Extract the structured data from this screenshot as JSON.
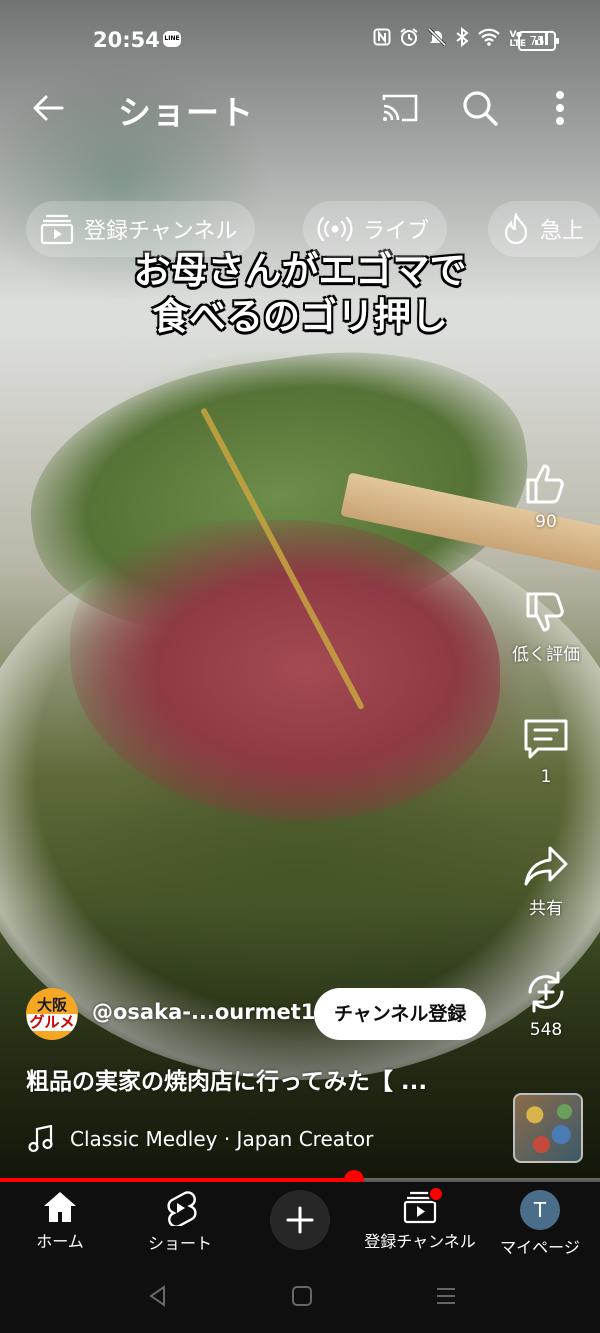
{
  "status_bar": {
    "time": "20:54",
    "line_icon_text": "LINE",
    "battery": "75",
    "icons": [
      "nfc-icon",
      "alarm-icon",
      "mute-icon",
      "bluetooth-icon",
      "wifi-icon",
      "volte-icon",
      "signal-icon",
      "battery-icon"
    ]
  },
  "header": {
    "title": "ショート"
  },
  "chips": [
    {
      "label": "登録チャンネル",
      "icon": "subscriptions-icon"
    },
    {
      "label": "ライブ",
      "icon": "live-icon"
    },
    {
      "label": "急上",
      "icon": "trending-icon"
    }
  ],
  "video": {
    "caption_line1": "お母さんがエゴマで",
    "caption_line2": "食べるのゴリ押し",
    "progress": 0.59
  },
  "actions": {
    "likes": "90",
    "dislike_label": "低く評価",
    "comments": "1",
    "share_label": "共有",
    "remix_count": "548"
  },
  "channel": {
    "avatar_line1": "大阪",
    "avatar_line2": "グルメ",
    "handle": "@osaka-...ourmet1",
    "subscribe_label": "チャンネル登録"
  },
  "video_title": "粗品の実家の焼肉店に行ってみた【 ...",
  "music": {
    "label": "Classic Medley · Japan Creator"
  },
  "bottom_nav": [
    {
      "label": "ホーム",
      "icon": "home-icon"
    },
    {
      "label": "ショート",
      "icon": "shorts-icon"
    },
    {
      "label": "",
      "icon": "create-icon"
    },
    {
      "label": "登録チャンネル",
      "icon": "subscriptions-icon"
    },
    {
      "label": "マイページ",
      "icon": "profile-avatar",
      "avatar_letter": "T"
    }
  ],
  "colors": {
    "accent": "#ff0000",
    "nav_background": "#0f0f0f",
    "chip_background": "rgba(255,255,255,0.22)"
  }
}
